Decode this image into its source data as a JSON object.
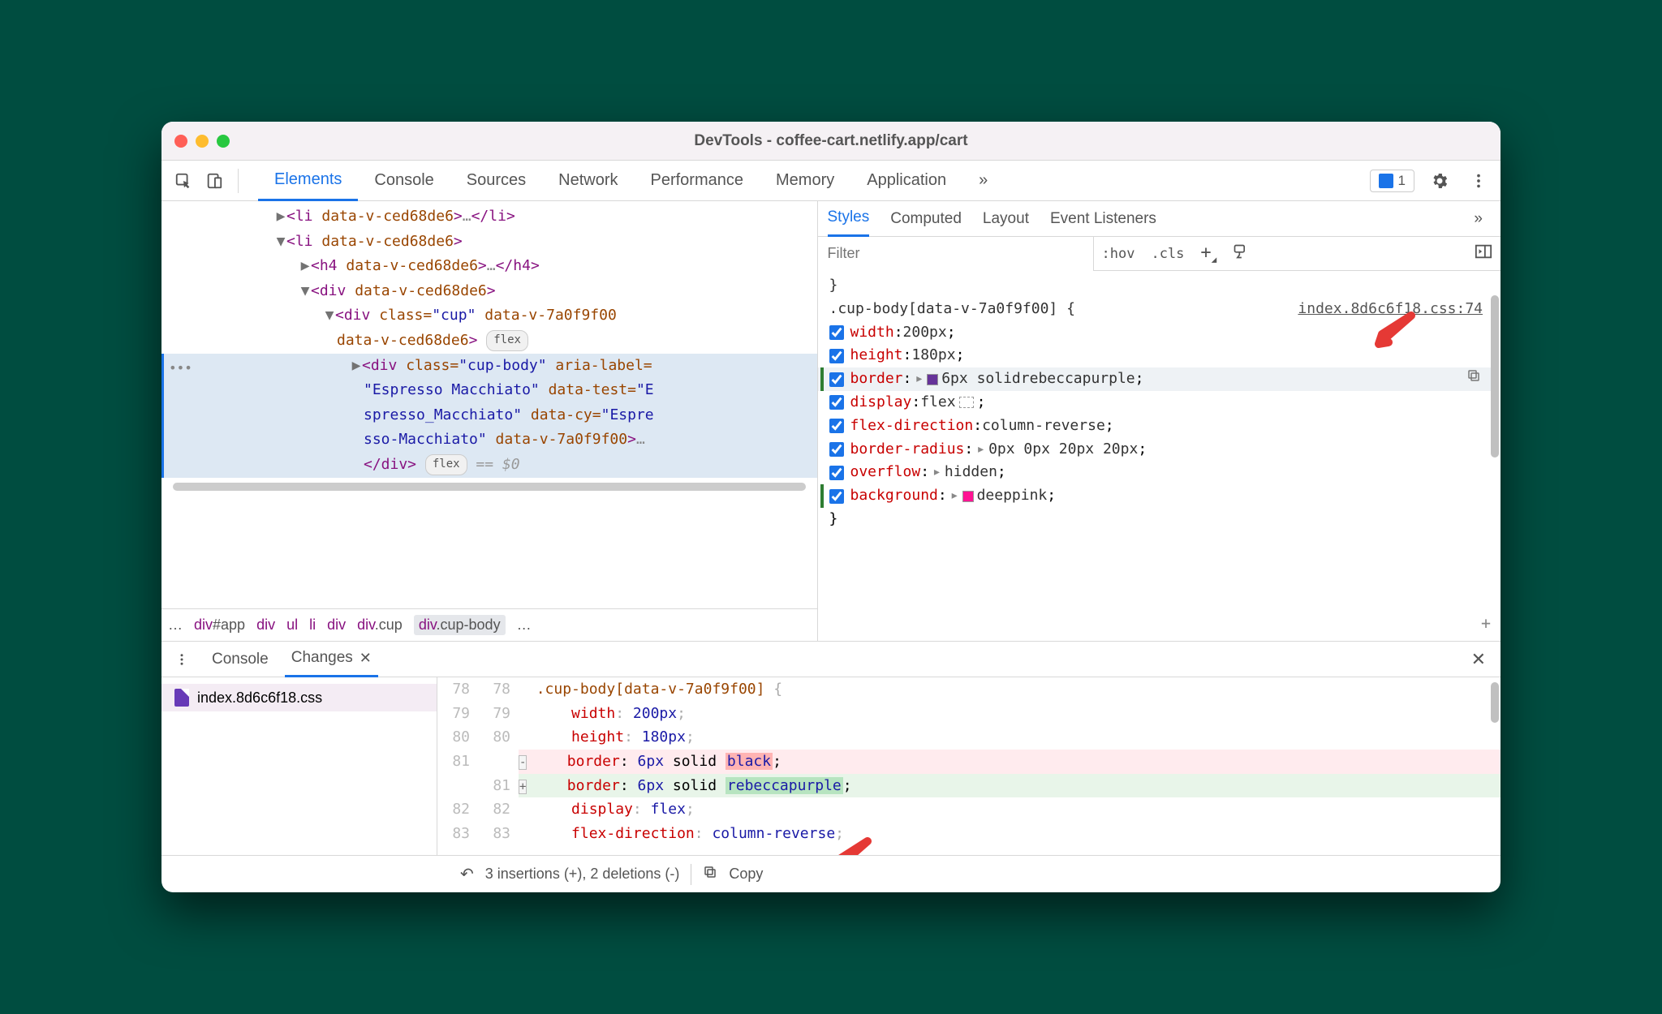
{
  "window": {
    "title": "DevTools - coffee-cart.netlify.app/cart"
  },
  "mainTabs": {
    "items": [
      "Elements",
      "Console",
      "Sources",
      "Network",
      "Performance",
      "Memory",
      "Application"
    ],
    "active": 0,
    "more": "»",
    "issueCount": "1"
  },
  "domTree": {
    "line1": {
      "open": "<li",
      "attr": " data-v-ced68de6",
      "close": ">",
      "ell": "…",
      "closeTag": "</li>"
    },
    "line2": {
      "open": "<li",
      "attr": " data-v-ced68de6",
      "close": ">"
    },
    "line3": {
      "open": "<h4",
      "attr": " data-v-ced68de6",
      "close": ">",
      "ell": "…",
      "closeTag": "</h4>"
    },
    "line4": {
      "open": "<div",
      "attr": " data-v-ced68de6",
      "close": ">"
    },
    "line5a": {
      "open": "<div",
      "classAttr": " class=",
      "classVal": "\"cup\"",
      "attrs": " data-v-7a0f9f00"
    },
    "line5b": {
      "attrs": "data-v-ced68de6",
      "close": ">",
      "pill": "flex"
    },
    "line6a": {
      "open": "<div",
      "classAttr": " class=",
      "classVal": "\"cup-body\"",
      "ariaAttr": " aria-label="
    },
    "line6b": {
      "text": "\"Espresso Macchiato\"",
      "attr1": " data-test=",
      "val1": "\"E"
    },
    "line6c": {
      "text": "spresso_Macchiato\"",
      "attr2": " data-cy=",
      "val2": "\"Espre"
    },
    "line6d": {
      "text": "sso-Macchiato\"",
      "attr3": " data-v-7a0f9f00",
      "close": ">",
      "ell": "…"
    },
    "line7": {
      "closeTag": "</div>",
      "pill": "flex",
      "eq": " == $0"
    },
    "dots": "•••"
  },
  "breadcrumb": {
    "ell": "…",
    "items": [
      "div#app",
      "div",
      "ul",
      "li",
      "div",
      "div.cup",
      "div.cup-body"
    ],
    "ellR": "…"
  },
  "stylesTabs": {
    "items": [
      "Styles",
      "Computed",
      "Layout",
      "Event Listeners"
    ],
    "active": 0,
    "more": "»"
  },
  "filter": {
    "placeholder": "Filter",
    "hov": ":hov",
    "cls": ".cls"
  },
  "rule": {
    "closeBraceTop": "}",
    "selector": ".cup-body[data-v-7a0f9f00] {",
    "link": "index.8d6c6f18.css:74",
    "props": [
      {
        "name": "width",
        "val": "200px",
        "expand": false
      },
      {
        "name": "height",
        "val": "180px",
        "expand": false
      },
      {
        "name": "border",
        "val": "6px solid ",
        "swatch": "#663399",
        "valEnd": "rebeccapurple",
        "expand": true,
        "highlight": true,
        "copy": true
      },
      {
        "name": "display",
        "val": "flex",
        "flexbadge": true,
        "expand": false
      },
      {
        "name": "flex-direction",
        "val": "column-reverse",
        "expand": false
      },
      {
        "name": "border-radius",
        "val": "0px 0px 20px 20px",
        "expand": true
      },
      {
        "name": "overflow",
        "val": "hidden",
        "expand": true
      },
      {
        "name": "background",
        "val": "",
        "swatch": "#ff1493",
        "valEnd": "deeppink",
        "expand": true,
        "green": true
      }
    ],
    "closeBrace": "}"
  },
  "drawerTabs": {
    "console": "Console",
    "changes": "Changes"
  },
  "changes": {
    "file": "index.8d6c6f18.css",
    "lines": [
      {
        "ln1": "78",
        "ln2": "78",
        "text": ".cup-body",
        "bracket": "[data-v-7a0f9f00]",
        "brace": " {",
        "faded": true
      },
      {
        "ln1": "79",
        "ln2": "79",
        "indent": "      ",
        "prop": "width",
        "sep": ": ",
        "val": "200px",
        "semi": ";",
        "faded": true
      },
      {
        "ln1": "80",
        "ln2": "80",
        "indent": "      ",
        "prop": "height",
        "sep": ": ",
        "val": "180px",
        "semi": ";",
        "faded": true
      },
      {
        "ln1": "81",
        "ln2": "",
        "sign": "-",
        "removed": true,
        "indent": "    ",
        "prop": "border",
        "sep": ": ",
        "val1": "6px",
        "val2": " solid ",
        "hl": "black",
        "semi": ";"
      },
      {
        "ln1": "",
        "ln2": "81",
        "sign": "+",
        "added": true,
        "indent": "    ",
        "prop": "border",
        "sep": ": ",
        "val1": "6px",
        "val2": " solid ",
        "hl": "rebeccapurple",
        "semi": ";"
      },
      {
        "ln1": "82",
        "ln2": "82",
        "indent": "      ",
        "prop": "display",
        "sep": ": ",
        "val": "flex",
        "semi": ";",
        "faded": true
      },
      {
        "ln1": "83",
        "ln2": "83",
        "indent": "      ",
        "prop": "flex-direction",
        "sep": ": ",
        "val": "column-reverse",
        "semi": ";",
        "faded": true
      }
    ],
    "footer": {
      "summary": "3 insertions (+), 2 deletions (-)",
      "copy": "Copy"
    }
  }
}
